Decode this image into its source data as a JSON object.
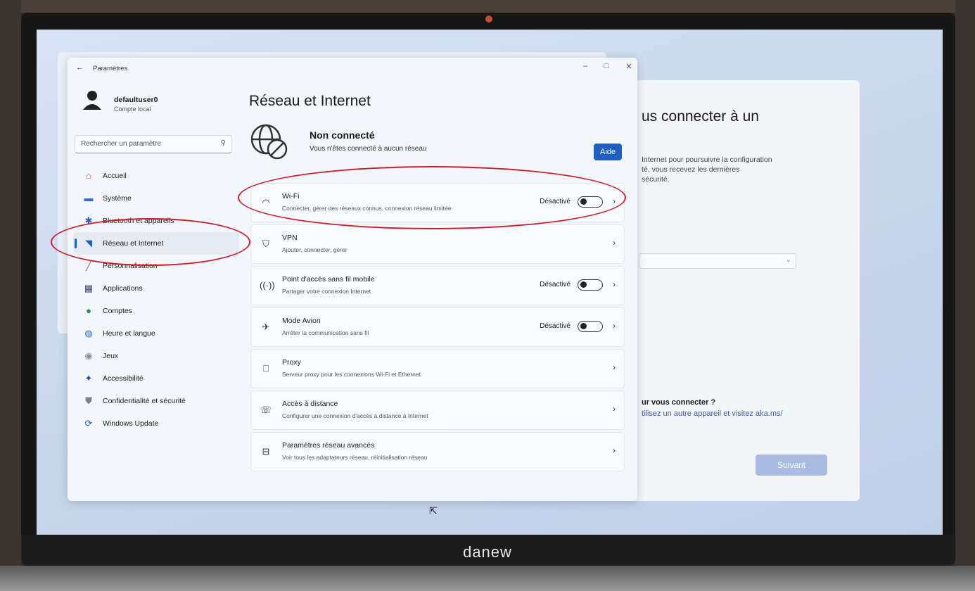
{
  "device": {
    "brand": "danew"
  },
  "settings": {
    "window_title": "Paramètres",
    "user": {
      "name": "defaultuser0",
      "account_type": "Compte local"
    },
    "search": {
      "placeholder": "Rechercher un paramètre"
    },
    "nav_items": [
      {
        "label": "Accueil",
        "icon": "home-icon",
        "selected": false
      },
      {
        "label": "Système",
        "icon": "system-icon",
        "selected": false
      },
      {
        "label": "Bluetooth et appareils",
        "icon": "bluetooth-icon",
        "selected": false
      },
      {
        "label": "Réseau et Internet",
        "icon": "wifi-icon",
        "selected": true
      },
      {
        "label": "Personnalisation",
        "icon": "brush-icon",
        "selected": false
      },
      {
        "label": "Applications",
        "icon": "apps-icon",
        "selected": false
      },
      {
        "label": "Comptes",
        "icon": "accounts-icon",
        "selected": false
      },
      {
        "label": "Heure et langue",
        "icon": "globe-icon",
        "selected": false
      },
      {
        "label": "Jeux",
        "icon": "gamepad-icon",
        "selected": false
      },
      {
        "label": "Accessibilité",
        "icon": "accessibility-icon",
        "selected": false
      },
      {
        "label": "Confidentialité et sécurité",
        "icon": "shield-icon",
        "selected": false
      },
      {
        "label": "Windows Update",
        "icon": "update-icon",
        "selected": false
      }
    ],
    "page_title": "Réseau et Internet",
    "status": {
      "title": "Non connecté",
      "subtitle": "Vous n'êtes connecté à aucun réseau",
      "help_label": "Aide"
    },
    "rows": [
      {
        "title": "Wi-Fi",
        "subtitle": "Connecter, gérer des réseaux connus, connexion réseau limitée",
        "state": "Désactivé",
        "toggle": true,
        "icon": "wifi-icon"
      },
      {
        "title": "VPN",
        "subtitle": "Ajouter, connecter, gérer",
        "state": "",
        "toggle": false,
        "icon": "vpn-shield-icon"
      },
      {
        "title": "Point d'accès sans fil mobile",
        "subtitle": "Partager votre connexion Internet",
        "state": "Désactivé",
        "toggle": true,
        "icon": "hotspot-icon"
      },
      {
        "title": "Mode Avion",
        "subtitle": "Arrêter la communication sans fil",
        "state": "Désactivé",
        "toggle": true,
        "icon": "airplane-icon"
      },
      {
        "title": "Proxy",
        "subtitle": "Serveur proxy pour les connexions Wi-Fi et Ethernet",
        "state": "",
        "toggle": false,
        "icon": "proxy-icon"
      },
      {
        "title": "Accès à distance",
        "subtitle": "Configurer une connexion d'accès à distance à Internet",
        "state": "",
        "toggle": false,
        "icon": "dialup-icon"
      },
      {
        "title": "Paramètres réseau avancés",
        "subtitle": "Voir tous les adaptateurs réseau, réinitialisation réseau",
        "state": "",
        "toggle": false,
        "icon": "monitor-network-icon"
      }
    ]
  },
  "oobe": {
    "title_partial": "us connecter à un",
    "desc_line1": "Internet pour poursuivre la configuration",
    "desc_line2": "té, vous recevez les dernières",
    "desc_line3": "sécurité.",
    "question_partial": "ur vous connecter ?",
    "alt_partial": "tilisez un autre appareil et visitez aka.ms/",
    "next_label": "Suivant"
  },
  "colors": {
    "accent": "#1f5fbf",
    "annotation": "#d21c2b"
  }
}
